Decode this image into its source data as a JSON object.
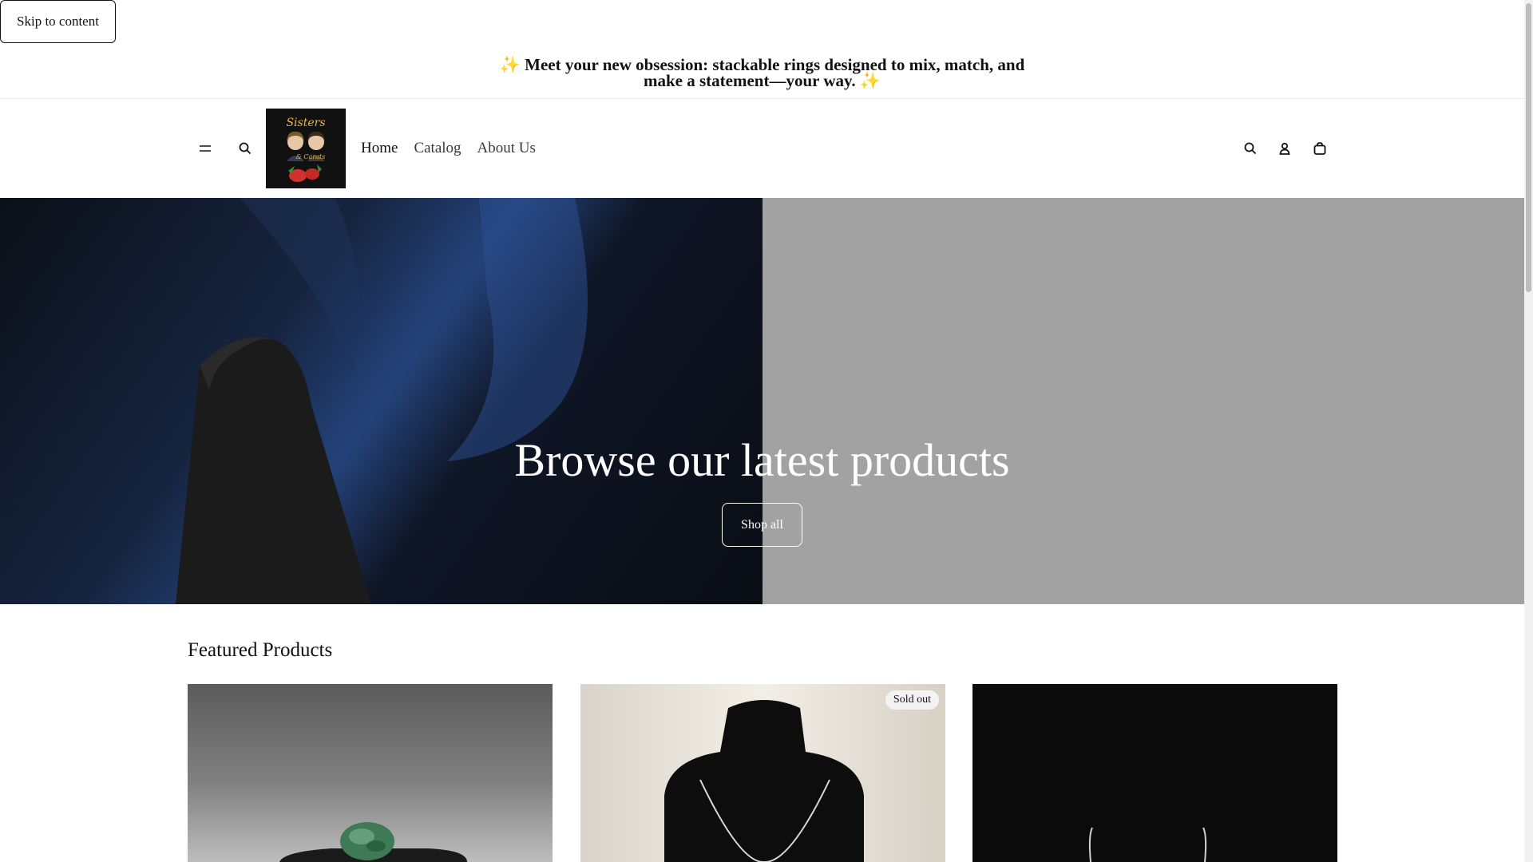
{
  "skip_link": "Skip to content",
  "announcement": "✨ Meet your new obsession: stackable rings designed to mix, match, and make a statement—your way. ✨",
  "header": {
    "icons": [
      "menu-icon",
      "search-icon",
      "search-icon",
      "account-icon",
      "cart-icon"
    ],
    "logo_text": "Sisters & Carats",
    "nav": [
      "Home",
      "Catalog",
      "About Us"
    ]
  },
  "hero": {
    "title": "Browse our latest products",
    "button": "Shop all"
  },
  "featured": {
    "title": "Featured Products",
    "products": [
      {
        "badge": ""
      },
      {
        "badge": "Sold out"
      },
      {
        "badge": ""
      }
    ]
  },
  "colors": {
    "text": "#121212",
    "hero_right": "#a2a2a2",
    "logo_bg": "#111111"
  }
}
